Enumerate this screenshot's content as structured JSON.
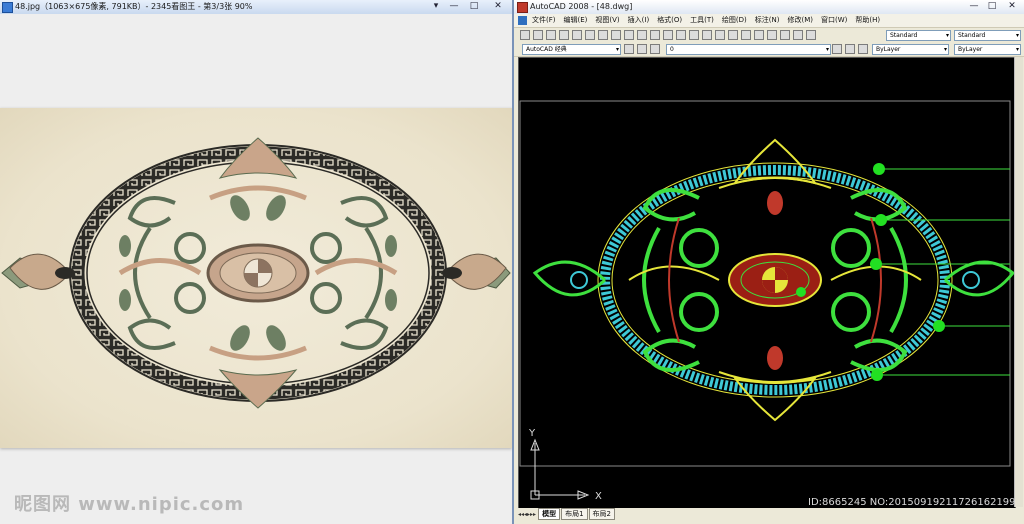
{
  "viewer": {
    "title": "48.jpg（1063×675像素, 791KB）- 2345看图王 - 第3/3张 90%",
    "buttons": {
      "menu": "▾",
      "minimize": "—",
      "maximize": "□",
      "close": "✕"
    },
    "watermark": "昵图网 www.nipic.com"
  },
  "cad": {
    "title": "AutoCAD 2008 - [48.dwg]",
    "title_buttons": {
      "minimize": "—",
      "maximize": "□",
      "close": "✕"
    },
    "menus": [
      "文件(F)",
      "编辑(E)",
      "视图(V)",
      "插入(I)",
      "格式(O)",
      "工具(T)",
      "绘图(D)",
      "标注(N)",
      "修改(M)",
      "窗口(W)",
      "帮助(H)"
    ],
    "toolbar1": {
      "text_style": "Standard",
      "dim_style": "Standard"
    },
    "toolbar2": {
      "workspace": "AutoCAD 经典",
      "layer": "0",
      "color": "ByLayer",
      "linetype": "ByLayer"
    },
    "ucs": {
      "x_label": "X",
      "y_label": "Y"
    },
    "tabs": {
      "nav": "◂◂◂▸▸▸",
      "model": "模型",
      "layout1": "布局1",
      "layout2": "布局2"
    },
    "image_id": "ID:8665245 NO:20150919211726162199"
  }
}
